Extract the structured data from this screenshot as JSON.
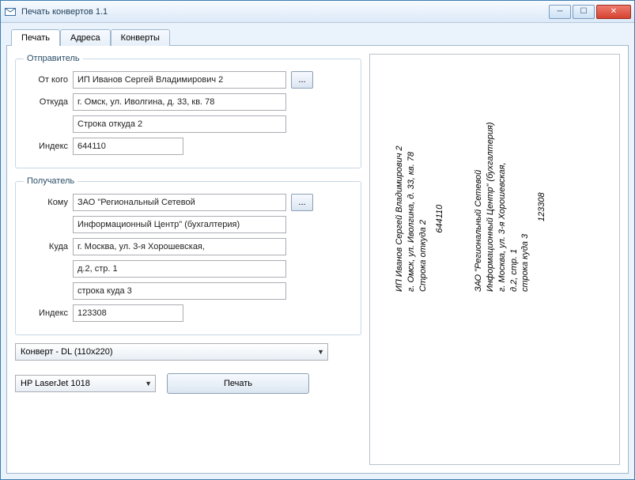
{
  "window": {
    "title": "Печать конвертов 1.1"
  },
  "tabs": {
    "print": "Печать",
    "addresses": "Адреса",
    "envelopes": "Конверты"
  },
  "sender": {
    "legend": "Отправитель",
    "from_label": "От кого",
    "from_value": "ИП Иванов Сергей Владимирович 2",
    "where_label": "Откуда",
    "addr1": "г. Омск, ул. Иволгина, д. 33, кв. 78",
    "addr2": "Строка откуда 2",
    "index_label": "Индекс",
    "index": "644110",
    "ellipsis": "..."
  },
  "recipient": {
    "legend": "Получатель",
    "to_label": "Кому",
    "to1": "ЗАО \"Региональный Сетевой",
    "to2": "Информационный Центр\" (бухгалтерия)",
    "where_label": "Куда",
    "addr1": "г. Москва, ул. 3-я Хорошевская,",
    "addr2": "д.2, стр. 1",
    "addr3": "строка куда 3",
    "index_label": "Индекс",
    "index": "123308",
    "ellipsis": "..."
  },
  "envelope": {
    "selected": "Конверт - DL (110x220)"
  },
  "printer": {
    "selected": "HP LaserJet 1018"
  },
  "print_button": "Печать",
  "preview": {
    "sender_lines": [
      "ИП Иванов Сергей Владимирович 2",
      "г. Омск, ул. Иволгина, д. 33, кв. 78",
      "Строка откуда 2",
      "644110"
    ],
    "recipient_lines": [
      "ЗАО \"Региональный Сетевой",
      "Информационный Центр\" (бухгалтерия)",
      "г. Москва, ул. 3-я Хорошевская,",
      "д.2, стр. 1",
      "строка куда 3",
      "123308"
    ]
  }
}
